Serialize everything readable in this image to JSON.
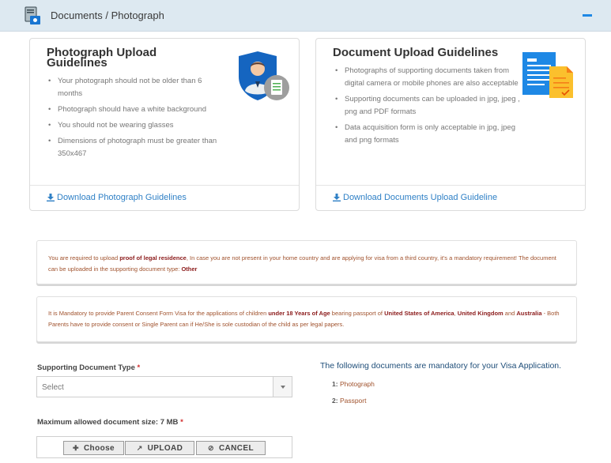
{
  "header": {
    "title": "Documents / Photograph",
    "collapse_icon": "minus-icon"
  },
  "photo_guidelines": {
    "title": "Photograph Upload Guidelines",
    "items": [
      "Your photograph should not be older than 6 months",
      "Photograph should have a white background",
      "You should not be wearing glasses",
      "Dimensions of photograph must be greater than 350x467"
    ],
    "download_label": "Download Photograph Guidelines"
  },
  "document_guidelines": {
    "title": "Document Upload Guidelines",
    "items": [
      "Photographs of supporting documents taken from digital camera or mobile phones are also acceptable",
      "Supporting documents can be uploaded in jpg, jpeg , png and PDF formats",
      "Data acquisition form is only acceptable in jpg, jpeg and png formats"
    ],
    "download_label": "Download Documents Upload Guideline"
  },
  "notice1": {
    "t1": "You are required to upload ",
    "b1": "proof of legal residence",
    "t2": ", In case you are not present in your home country and are applying for visa from a third country, it's a mandatory requirement! The document can be uploaded in the supporting document type: ",
    "b2": "Other"
  },
  "notice2": {
    "t1": "It is Mandatory to provide Parent Consent Form Visa for the applications of children ",
    "b1": "under 18 Years of Age",
    "t2": " bearing passport of ",
    "b2": "United States of America",
    "t3": ", ",
    "b3": "United Kingdom",
    "t4": " and ",
    "b4": "Australia",
    "t5": " - Both Parents have to provide consent or Single Parent can if He/She is sole custodian of the child as per legal papers."
  },
  "form": {
    "doc_type_label": "Supporting Document Type",
    "required_mark": "*",
    "select_value": "Select",
    "max_size_label": "Maximum allowed document size: 7 MB",
    "choose_label": "Choose",
    "upload_label": "UPLOAD",
    "cancel_label": "CANCEL"
  },
  "mandatory": {
    "title": "The following documents are mandatory for your Visa Application.",
    "items": [
      {
        "num": "1:",
        "name": "Photograph"
      },
      {
        "num": "2:",
        "name": "Passport"
      }
    ]
  },
  "colors": {
    "header_bg": "#dde9f1",
    "link": "#2f80c6",
    "notice_text": "#a0522d",
    "required": "#d32f2f"
  }
}
